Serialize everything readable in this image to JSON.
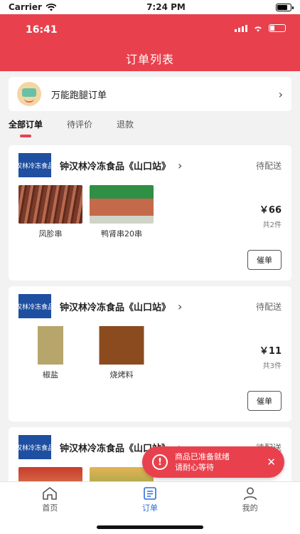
{
  "ios_status": {
    "carrier": "Carrier",
    "time": "7:24 PM"
  },
  "app_status": {
    "time": "16:41"
  },
  "header": {
    "title": "订单列表"
  },
  "errand": {
    "label": "万能跑腿订单"
  },
  "tabs": [
    {
      "label": "全部订单"
    },
    {
      "label": "待评价"
    },
    {
      "label": "退款"
    }
  ],
  "orders": [
    {
      "logo_text": "汉林冷冻食品",
      "shop": "钟汉林冷冻食品《山口站》",
      "status": "待配送",
      "goods": [
        {
          "name": "凤胗串"
        },
        {
          "name": "鸭肾串20串"
        }
      ],
      "price": "￥66",
      "count": "共2件",
      "urge": "催单"
    },
    {
      "logo_text": "汉林冷冻食品",
      "shop": "钟汉林冷冻食品《山口站》",
      "status": "待配送",
      "goods": [
        {
          "name": "椒盐"
        },
        {
          "name": "烧烤料"
        }
      ],
      "price": "￥11",
      "count": "共3件",
      "urge": "催单"
    },
    {
      "logo_text": "汉林冷冻食品",
      "shop": "钟汉林冷冻食品《山口站》",
      "status": "待配送"
    }
  ],
  "toast": {
    "line1": "商品已准备就绪",
    "line2": "请耐心等待"
  },
  "tabbar": [
    {
      "label": "首页"
    },
    {
      "label": "订单"
    },
    {
      "label": "我的"
    }
  ],
  "colors": {
    "brand_red": "#e8414d",
    "active_blue": "#2e6bd8"
  }
}
